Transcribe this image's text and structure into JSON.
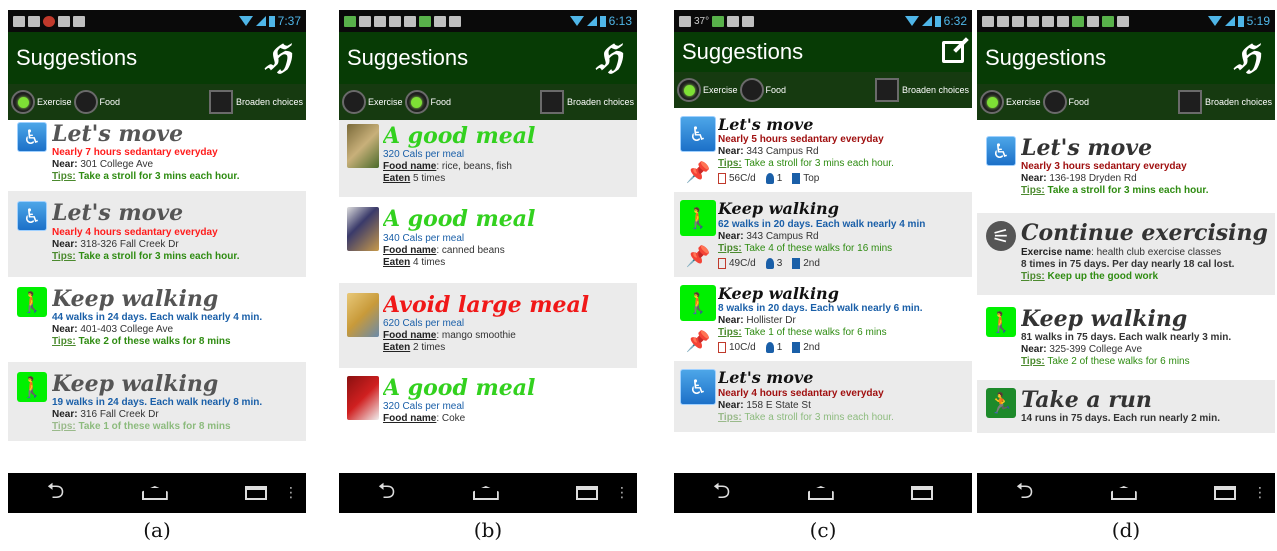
{
  "screens": [
    {
      "caption": "(a)",
      "time": "7:37",
      "title": "Suggestions",
      "filters": {
        "exercise": "Exercise",
        "food": "Food",
        "broaden": "Broaden choices"
      },
      "items": [
        {
          "title": "Let's move",
          "l1": "Nearly 7 hours sedantary everyday",
          "near_label": "Near:",
          "near": "301 College Ave",
          "tips_label": "Tips:",
          "tips": "Take a stroll for 3 mins each hour."
        },
        {
          "title": "Let's move",
          "l1": "Nearly 4 hours sedantary everyday",
          "near_label": "Near:",
          "near": "318-326 Fall Creek Dr",
          "tips_label": "Tips:",
          "tips": "Take a stroll for 3 mins each hour."
        },
        {
          "title": "Keep walking",
          "l1": "44 walks in 24 days. Each walk nearly 4 min.",
          "near_label": "Near:",
          "near": "401-403 College Ave",
          "tips_label": "Tips:",
          "tips": "Take 2 of these walks for 8 mins"
        },
        {
          "title": "Keep walking",
          "l1": "19 walks in 24 days. Each walk nearly 8 min.",
          "near_label": "Near:",
          "near": "316 Fall Creek Dr",
          "tips_label": "Tips:",
          "tips": "Take 1 of these walks for 8 mins"
        }
      ]
    },
    {
      "caption": "(b)",
      "time": "6:13",
      "title": "Suggestions",
      "filters": {
        "exercise": "Exercise",
        "food": "Food",
        "broaden": "Broaden choices"
      },
      "items": [
        {
          "title": "A good meal",
          "cals": "320 Cals per meal",
          "food_label": "Food name",
          "food": ": rice, beans, fish",
          "eaten_label": "Eaten",
          "eaten": " 5 times"
        },
        {
          "title": "A good meal",
          "cals": "340 Cals per meal",
          "food_label": "Food name",
          "food": ": canned beans",
          "eaten_label": "Eaten",
          "eaten": " 4 times"
        },
        {
          "title": "Avoid large meal",
          "cals": "620 Cals per meal",
          "food_label": "Food name",
          "food": ": mango smoothie",
          "eaten_label": "Eaten",
          "eaten": " 2 times"
        },
        {
          "title": "A good meal",
          "cals": "320 Cals per meal",
          "food_label": "Food name",
          "food": ": Coke",
          "eaten_label": "",
          "eaten": ""
        }
      ]
    },
    {
      "caption": "(c)",
      "time": "6:32",
      "status_temp": "37°",
      "title": "Suggestions",
      "filters": {
        "exercise": "Exercise",
        "food": "Food",
        "broaden": "Broaden choices"
      },
      "items": [
        {
          "title": "Let's move",
          "l1": "Nearly 5 hours sedantary everyday",
          "near_label": "Near:",
          "near": "343 Campus Rd",
          "tips_label": "Tips:",
          "tips": "Take a stroll for 3 mins each hour.",
          "cal": "56C/d",
          "people": "1",
          "rank": "Top"
        },
        {
          "title": "Keep walking",
          "l1": "62 walks in 20 days. Each walk nearly 4 min",
          "near_label": "Near:",
          "near": "343 Campus Rd",
          "tips_label": "Tips:",
          "tips": "Take 4 of these walks for 16 mins",
          "cal": "49C/d",
          "people": "3",
          "rank": "2nd"
        },
        {
          "title": "Keep walking",
          "l1": "8 walks in 20 days. Each walk nearly 6 min.",
          "near_label": "Near:",
          "near": "Hollister Dr",
          "tips_label": "Tips:",
          "tips": "Take 1 of these walks for 6 mins",
          "cal": "10C/d",
          "people": "1",
          "rank": "2nd"
        },
        {
          "title": "Let's move",
          "l1": "Nearly 4 hours sedantary everyday",
          "near_label": "Near:",
          "near": "158 E State St",
          "tips_label": "Tips:",
          "tips": "Take a stroll for 3 mins each hour."
        }
      ]
    },
    {
      "caption": "(d)",
      "time": "5:19",
      "title": "Suggestions",
      "filters": {
        "exercise": "Exercise",
        "food": "Food",
        "broaden": "Broaden choices"
      },
      "items": [
        {
          "title": "Let's move",
          "l1": "Nearly 3 hours sedantary everyday",
          "near_label": "Near:",
          "near": "136-198 Dryden Rd",
          "tips_label": "Tips:",
          "tips": "Take a stroll for 3 mins each hour."
        },
        {
          "title": "Continue exercising",
          "ex_label": "Exercise name",
          "ex": ": health club exercise classes",
          "l2": "8 times in 75 days. Per day nearly 18 cal lost.",
          "tips_label": "Tips:",
          "tips": "Keep up the good work"
        },
        {
          "title": "Keep walking",
          "l1": "81 walks in 75 days. Each walk nearly 3 min.",
          "near_label": "Near:",
          "near": "325-399 College Ave",
          "tips_label": "Tips:",
          "tips": "Take 2 of these walks for 6 mins"
        },
        {
          "title": "Take a run",
          "l1": "14 runs in 75 days. Each run nearly 2 min."
        }
      ]
    }
  ]
}
